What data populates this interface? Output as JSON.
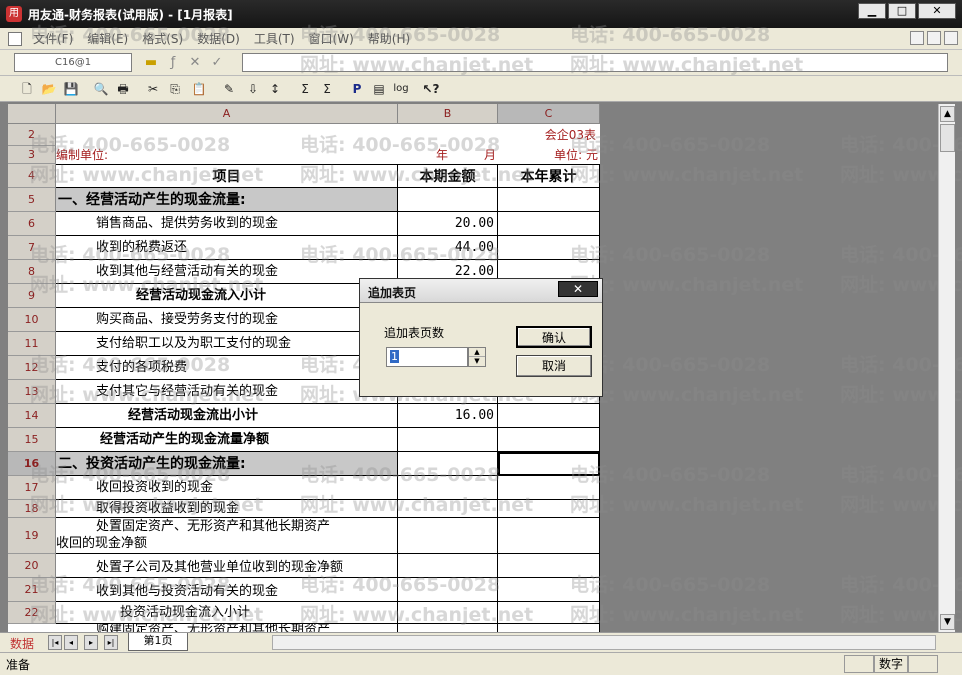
{
  "window": {
    "title": "用友通-财务报表(试用版) - [1月报表]",
    "min": "▁",
    "max": "□",
    "close": "✕"
  },
  "menu": [
    "文件(F)",
    "编辑(E)",
    "格式(S)",
    "数据(D)",
    "工具(T)",
    "窗口(W)",
    "帮助(H)"
  ],
  "editbar": {
    "cell_ref": "C16@1",
    "formula": ""
  },
  "sheet": {
    "col_headers": [
      "A",
      "B",
      "C"
    ],
    "row_numbers": [
      "2",
      "3",
      "4",
      "5",
      "6",
      "7",
      "8",
      "9",
      "10",
      "11",
      "12",
      "13",
      "14",
      "15",
      "16",
      "17",
      "18",
      "19",
      "20",
      "21",
      "22"
    ],
    "form_code": "会企03表",
    "unit_label": "编制单位:",
    "year_label": "年",
    "month_label": "月",
    "currency_label": "单位: 元",
    "head_item": "项目",
    "head_current": "本期金额",
    "head_ytd": "本年累计",
    "rows": [
      {
        "label": "一、经营活动产生的现金流量:",
        "value": ""
      },
      {
        "label": "销售商品、提供劳务收到的现金",
        "value": "20.00"
      },
      {
        "label": "收到的税费返还",
        "value": "44.00"
      },
      {
        "label": "收到其他与经营活动有关的现金",
        "value": "22.00"
      },
      {
        "label": "经营活动现金流入小计",
        "value": ""
      },
      {
        "label": "购买商品、接受劳务支付的现金",
        "value": ""
      },
      {
        "label": "支付给职工以及为职工支付的现金",
        "value": ""
      },
      {
        "label": "支付的各项税费",
        "value": ""
      },
      {
        "label": "支付其它与经营活动有关的现金",
        "value": ""
      },
      {
        "label": "经营活动现金流出小计",
        "value": "16.00"
      },
      {
        "label": "经营活动产生的现金流量净额",
        "value": ""
      },
      {
        "label": "二、投资活动产生的现金流量:",
        "value": ""
      },
      {
        "label": "收回投资收到的现金",
        "value": ""
      },
      {
        "label": "取得投资收益收到的现金",
        "value": ""
      },
      {
        "label": "处置固定资产、无形资产和其他长期资产",
        "label2": "收回的现金净额",
        "value": ""
      },
      {
        "label": "处置子公司及其他营业单位收到的现金净额",
        "value": ""
      },
      {
        "label": "收到其他与投资活动有关的现金",
        "value": ""
      },
      {
        "label": "投资活动现金流入小计",
        "value": ""
      },
      {
        "label": "购建固定资产、无形资产和其他长期资产",
        "value": ""
      }
    ]
  },
  "watermark": {
    "phone": "电话: 400-665-0028",
    "site": "网址: www.chanjet.net"
  },
  "bottom": {
    "data_label": "数据",
    "sheet_tab": "第1页"
  },
  "status": {
    "text": "准备",
    "mode": "数字"
  },
  "dialog": {
    "title": "追加表页",
    "close": "✕",
    "label": "追加表页数",
    "value": "1",
    "ok": "确认",
    "cancel": "取消"
  }
}
